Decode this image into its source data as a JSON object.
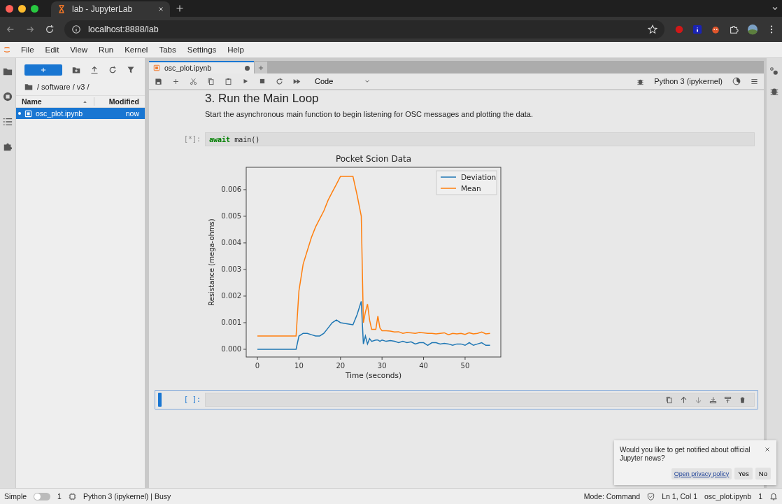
{
  "browser": {
    "tabs": [
      {
        "title": "lab - JupyterLab",
        "selected": true
      }
    ],
    "url": "localhost:8888/lab"
  },
  "menu": [
    "File",
    "Edit",
    "View",
    "Run",
    "Kernel",
    "Tabs",
    "Settings",
    "Help"
  ],
  "file_browser": {
    "breadcrumb": "/ software / v3 /",
    "columns": [
      "Name",
      "Modified"
    ],
    "files": [
      {
        "name": "osc_plot.ipynb",
        "modified": "now",
        "selected": true,
        "running": true
      }
    ]
  },
  "notebook": {
    "tabs": [
      {
        "title": "osc_plot.ipynb",
        "selected": true,
        "unsaved": true
      }
    ],
    "cell_type": "Code",
    "kernel": "Python 3 (ipykernel)",
    "cells": [
      {
        "kind": "markdown",
        "heading": "3. Run the Main Loop",
        "text": "Start the asynchronous main function to begin listening for OSC messages and plotting the data.",
        "selected": false
      },
      {
        "kind": "code",
        "prompt": "[*]:",
        "selected": false,
        "code": [
          {
            "kind": "keyword",
            "text": "await"
          },
          {
            "kind": "plain",
            "text": " main()"
          }
        ],
        "chart_data": {
          "type": "line",
          "title": "Pocket Scion Data",
          "xlabel": "Time (seconds)",
          "ylabel": "Resistance (mega-ohms)",
          "x": [
            0,
            9,
            9.3,
            10,
            11,
            12,
            13,
            14,
            15,
            16,
            17,
            18,
            19,
            20,
            21,
            22,
            23,
            24,
            25,
            25.5,
            26,
            26.5,
            27,
            27.5,
            28.5,
            29,
            29.5,
            30,
            31,
            32,
            33,
            34,
            35,
            36,
            37,
            38,
            39,
            40,
            41,
            42,
            43,
            44,
            45,
            46,
            47,
            48,
            49,
            50,
            51,
            52,
            53,
            54,
            55,
            56
          ],
          "series": [
            {
              "name": "Deviation",
              "color": "#1f77b4",
              "values": [
                0,
                0,
                0,
                0.0005,
                0.0006,
                0.0006,
                0.00055,
                0.0005,
                0.0005,
                0.0006,
                0.0008,
                0.001,
                0.0011,
                0.001,
                0.00097,
                0.00095,
                0.00092,
                0.0013,
                0.0018,
                0.0002,
                0.0005,
                0.0002,
                0.0004,
                0.0003,
                0.00035,
                0.00035,
                0.0003,
                0.00035,
                0.0003,
                0.00033,
                0.0003,
                0.00025,
                0.0003,
                0.00025,
                0.00028,
                0.0002,
                0.00025,
                0.00025,
                0.00015,
                0.00025,
                0.00025,
                0.0002,
                0.00022,
                0.0002,
                0.00015,
                0.0002,
                0.0002,
                0.00015,
                0.00025,
                0.00015,
                0.0002,
                0.00025,
                0.00015,
                0.00015
              ]
            },
            {
              "name": "Mean",
              "color": "#ff7f0e",
              "values": [
                0.0005,
                0.0005,
                0.0005,
                0.0022,
                0.0032,
                0.0037,
                0.0042,
                0.0046,
                0.0049,
                0.0052,
                0.0056,
                0.0059,
                0.0062,
                0.0065,
                0.0065,
                0.0065,
                0.0065,
                0.0058,
                0.005,
                0.001,
                0.0014,
                0.0017,
                0.0011,
                0.00075,
                0.00075,
                0.00125,
                0.0008,
                0.0007,
                0.0007,
                0.00068,
                0.00065,
                0.00066,
                0.0006,
                0.00063,
                0.00062,
                0.0006,
                0.00063,
                0.00062,
                0.0006,
                0.0006,
                0.00058,
                0.0006,
                0.00062,
                0.00055,
                0.0006,
                0.00058,
                0.0006,
                0.00056,
                0.00062,
                0.00058,
                0.0006,
                0.00065,
                0.00058,
                0.0006
              ]
            }
          ],
          "legend": "upper right",
          "xlim": [
            -2.7,
            58.6
          ],
          "ylim": [
            -0.00029,
            0.00684
          ],
          "xticks": [
            0,
            10,
            20,
            30,
            40,
            50
          ],
          "yticks": [
            {
              "value": 0,
              "label": "0.000"
            },
            {
              "value": 0.001,
              "label": "0.001"
            },
            {
              "value": 0.002,
              "label": "0.002"
            },
            {
              "value": 0.003,
              "label": "0.003"
            },
            {
              "value": 0.004,
              "label": "0.004"
            },
            {
              "value": 0.005,
              "label": "0.005"
            },
            {
              "value": 0.006,
              "label": "0.006"
            }
          ]
        }
      },
      {
        "kind": "code",
        "prompt": "[ ]:",
        "selected": true
      }
    ]
  },
  "notification": {
    "text": "Would you like to get notified about official Jupyter news?",
    "link": "Open privacy policy",
    "buttons": [
      "Yes",
      "No"
    ]
  },
  "status_bar": {
    "simple_label": "Simple",
    "simple_on": false,
    "terminals": "1",
    "kernel_status": "Python 3 (ipykernel) | Busy",
    "mode": "Mode: Command",
    "cursor": "Ln 1, Col 1",
    "file": "osc_plot.ipynb",
    "notifications": "1"
  }
}
